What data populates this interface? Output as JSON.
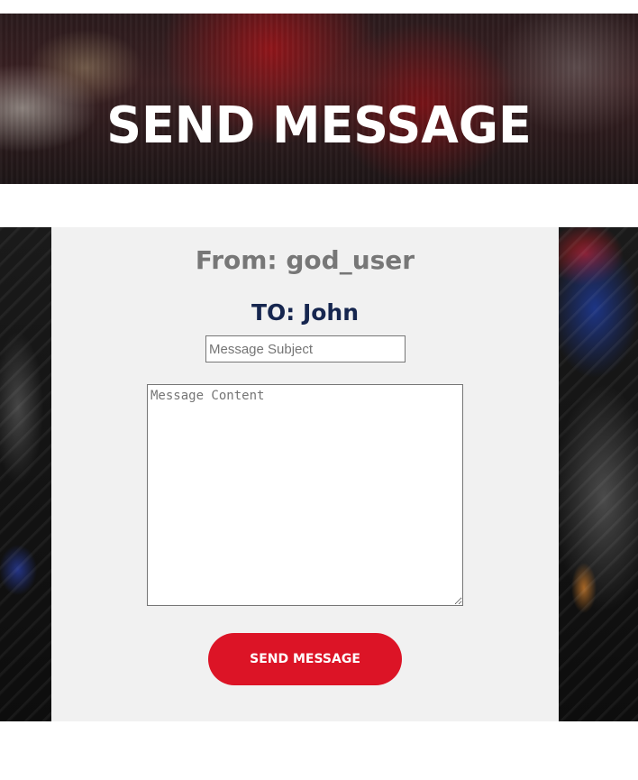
{
  "hero": {
    "title": "SEND MESSAGE"
  },
  "form": {
    "from_line": "From: god_user",
    "to_line": "TO: John",
    "subject": {
      "value": "",
      "placeholder": "Message Subject"
    },
    "content": {
      "value": "",
      "placeholder": "Message Content"
    },
    "send_button_label": "SEND MESSAGE"
  },
  "colors": {
    "accent": "#dc1426",
    "to_text": "#16264f",
    "from_text": "#777777",
    "card_background": "#f1f1f1"
  }
}
